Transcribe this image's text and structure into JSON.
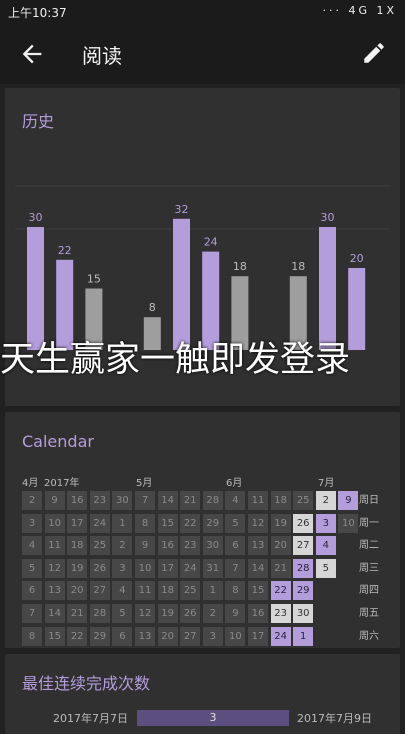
{
  "status_bar": {
    "time": "上午10:37",
    "icons_text": "··· 4G 1X"
  },
  "app_bar": {
    "title": "阅读"
  },
  "history": {
    "title": "历史",
    "chart_data": {
      "type": "bar",
      "values": [
        30,
        22,
        15,
        null,
        8,
        32,
        24,
        18,
        null,
        18,
        30,
        20
      ],
      "highlight": [
        true,
        true,
        false,
        false,
        false,
        true,
        true,
        false,
        false,
        false,
        true,
        true
      ],
      "colors": {
        "done": "#b39ddb",
        "partial": "#9e9e9e"
      }
    }
  },
  "calendar": {
    "title": "Calendar",
    "months": [
      {
        "label": "4月"
      },
      {
        "label": "2017年"
      },
      {
        "label": "5月"
      },
      {
        "label": "6月"
      },
      {
        "label": "7月"
      }
    ],
    "weekdays": [
      "周日",
      "周一",
      "周二",
      "周三",
      "周四",
      "周五",
      "周六"
    ],
    "columns": [
      [
        "2",
        "3",
        "4",
        "5",
        "6",
        "7",
        "8"
      ],
      [
        "9",
        "10",
        "11",
        "12",
        "13",
        "14",
        "15"
      ],
      [
        "16",
        "17",
        "18",
        "19",
        "20",
        "21",
        "22"
      ],
      [
        "23",
        "24",
        "25",
        "26",
        "27",
        "28",
        "29"
      ],
      [
        "30",
        "1",
        "2",
        "3",
        "4",
        "5",
        "6"
      ],
      [
        "7",
        "8",
        "9",
        "10",
        "11",
        "12",
        "13"
      ],
      [
        "14",
        "15",
        "16",
        "17",
        "18",
        "19",
        "20"
      ],
      [
        "21",
        "22",
        "23",
        "24",
        "25",
        "26",
        "27"
      ],
      [
        "28",
        "29",
        "30",
        "31",
        "1",
        "2",
        "3"
      ],
      [
        "4",
        "5",
        "6",
        "7",
        "8",
        "9",
        "10"
      ],
      [
        "11",
        "12",
        "13",
        "14",
        "15",
        "16",
        "17"
      ],
      [
        "18",
        "19",
        "20",
        "21",
        "22",
        "23",
        "24"
      ],
      [
        "25",
        "26",
        "27",
        "28",
        "29",
        "30",
        "1"
      ],
      [
        "2",
        "3",
        "4",
        "5",
        "",
        "",
        ""
      ],
      [
        "9",
        "10",
        "",
        "",
        "",
        "",
        ""
      ]
    ],
    "states": [
      [
        "",
        "",
        "",
        "",
        "",
        "",
        ""
      ],
      [
        "",
        "",
        "",
        "",
        "",
        "",
        ""
      ],
      [
        "",
        "",
        "",
        "",
        "",
        "",
        ""
      ],
      [
        "",
        "",
        "",
        "",
        "",
        "",
        ""
      ],
      [
        "",
        "",
        "",
        "",
        "",
        "",
        ""
      ],
      [
        "",
        "",
        "",
        "",
        "",
        "",
        ""
      ],
      [
        "",
        "",
        "",
        "",
        "",
        "",
        ""
      ],
      [
        "",
        "",
        "",
        "",
        "",
        "",
        ""
      ],
      [
        "",
        "",
        "",
        "",
        "",
        "",
        ""
      ],
      [
        "",
        "",
        "",
        "",
        "",
        "",
        ""
      ],
      [
        "",
        "",
        "",
        "",
        "",
        "",
        ""
      ],
      [
        "",
        "",
        "",
        "",
        "done",
        "partial",
        "done"
      ],
      [
        "",
        "partial",
        "partial",
        "done",
        "done",
        "partial",
        "done"
      ],
      [
        "partial",
        "done",
        "done",
        "partial",
        "",
        "",
        ""
      ],
      [
        "done",
        "",
        "",
        "",
        "",
        "",
        ""
      ]
    ]
  },
  "streak": {
    "title": "最佳连续完成次数",
    "start": "2017年7月7日",
    "count": "3",
    "end": "2017年7月9日"
  },
  "overlay": {
    "text": "天生赢家一触即发登录"
  }
}
